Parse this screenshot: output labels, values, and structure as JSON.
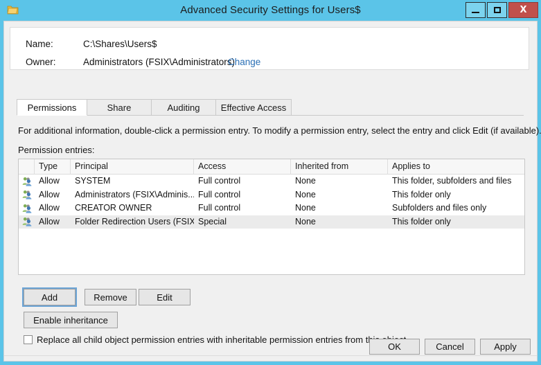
{
  "window": {
    "title": "Advanced Security Settings for Users$",
    "icon": "folder-icon",
    "caption": {
      "minimize_label": "–",
      "maximize_label": "□",
      "close_label": "X"
    },
    "colors": {
      "titlebar": "#5bc4e8",
      "close_button": "#c0504c",
      "link": "#2a6fb5",
      "dialog_bg": "#f0f0f0",
      "selected_row": "#ebebeb"
    }
  },
  "header": {
    "name_label": "Name:",
    "name_value": "C:\\Shares\\Users$",
    "owner_label": "Owner:",
    "owner_value": "Administrators (FSIX\\Administrators)",
    "change_link": "Change"
  },
  "tabs": [
    {
      "label": "Permissions",
      "active": true
    },
    {
      "label": "Share",
      "active": false
    },
    {
      "label": "Auditing",
      "active": false
    },
    {
      "label": "Effective Access",
      "active": false
    }
  ],
  "main": {
    "info_text": "For additional information, double-click a permission entry. To modify a permission entry, select the entry and click Edit (if available).",
    "entries_label": "Permission entries:"
  },
  "table": {
    "columns": [
      "",
      "Type",
      "Principal",
      "Access",
      "Inherited from",
      "Applies to"
    ],
    "rows": [
      {
        "icon": "users-group-icon",
        "type": "Allow",
        "principal": "SYSTEM",
        "access": "Full control",
        "inherited_from": "None",
        "applies_to": "This folder, subfolders and files",
        "selected": false
      },
      {
        "icon": "users-group-icon",
        "type": "Allow",
        "principal": "Administrators (FSIX\\Adminis...",
        "access": "Full control",
        "inherited_from": "None",
        "applies_to": "This folder only",
        "selected": false
      },
      {
        "icon": "users-group-icon",
        "type": "Allow",
        "principal": "CREATOR OWNER",
        "access": "Full control",
        "inherited_from": "None",
        "applies_to": "Subfolders and files only",
        "selected": false
      },
      {
        "icon": "users-group-icon",
        "type": "Allow",
        "principal": "Folder Redirection Users (FSIX...",
        "access": "Special",
        "inherited_from": "None",
        "applies_to": "This folder only",
        "selected": true
      }
    ]
  },
  "actions": {
    "add_label": "Add",
    "remove_label": "Remove",
    "edit_label": "Edit",
    "enable_inheritance_label": "Enable inheritance",
    "replace_checkbox_label": "Replace all child object permission entries with inheritable permission entries from this object",
    "replace_checkbox_checked": false
  },
  "footer": {
    "ok_label": "OK",
    "cancel_label": "Cancel",
    "apply_label": "Apply"
  }
}
